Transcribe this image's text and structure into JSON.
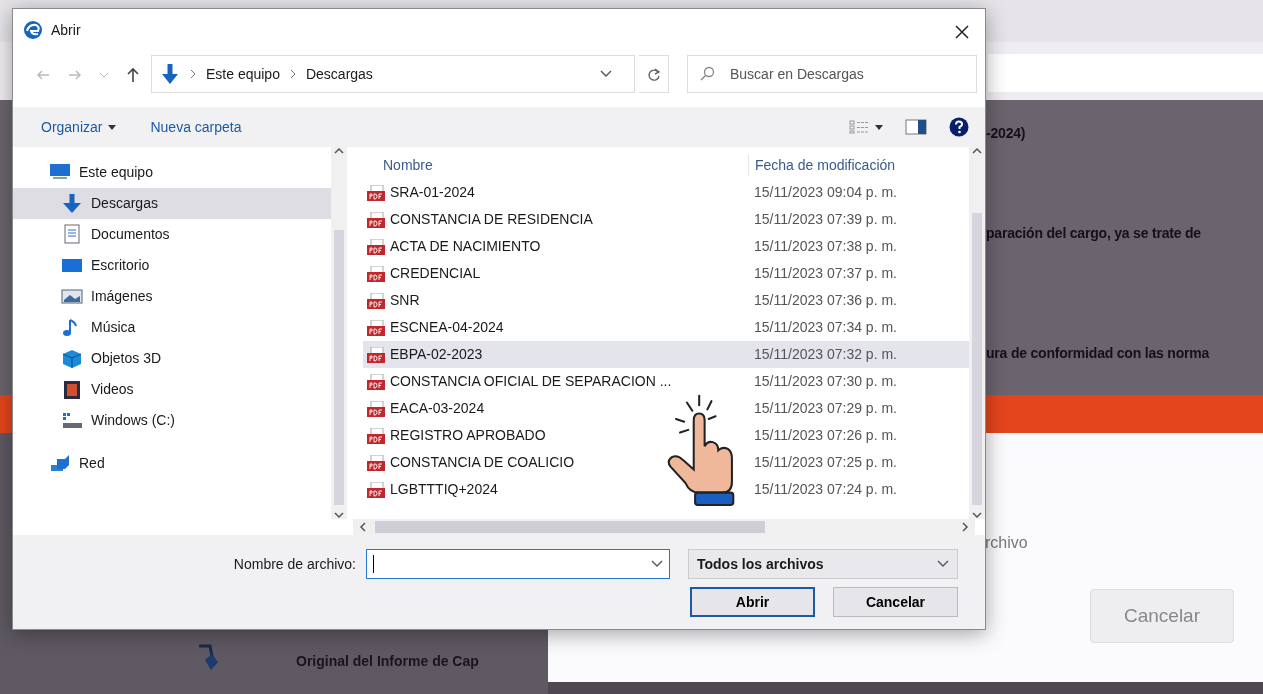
{
  "window": {
    "title": "Abrir"
  },
  "address": {
    "path": [
      "Este equipo",
      "Descargas"
    ]
  },
  "search": {
    "placeholder": "Buscar en Descargas"
  },
  "toolbar": {
    "organize": "Organizar",
    "new_folder": "Nueva carpeta"
  },
  "nav_pane": {
    "items": [
      {
        "label": "Este equipo",
        "kind": "computer",
        "selected": false,
        "children": [
          {
            "label": "Descargas",
            "kind": "downloads",
            "selected": true
          },
          {
            "label": "Documentos",
            "kind": "documents",
            "selected": false
          },
          {
            "label": "Escritorio",
            "kind": "desktop",
            "selected": false
          },
          {
            "label": "Imágenes",
            "kind": "pictures",
            "selected": false
          },
          {
            "label": "Música",
            "kind": "music",
            "selected": false
          },
          {
            "label": "Objetos 3D",
            "kind": "objects",
            "selected": false
          },
          {
            "label": "Videos",
            "kind": "videos",
            "selected": false
          },
          {
            "label": "Windows  (C:)",
            "kind": "drive",
            "selected": false
          }
        ]
      },
      {
        "label": "Red",
        "kind": "network",
        "selected": false
      }
    ]
  },
  "files": {
    "columns": [
      "Nombre",
      "Fecha de modificación"
    ],
    "rows": [
      {
        "name": "SRA-01-2024",
        "modified": "15/11/2023 09:04 p. m.",
        "selected": false
      },
      {
        "name": "CONSTANCIA DE RESIDENCIA",
        "modified": "15/11/2023 07:39 p. m.",
        "selected": false
      },
      {
        "name": "ACTA DE NACIMIENTO",
        "modified": "15/11/2023 07:38 p. m.",
        "selected": false
      },
      {
        "name": "CREDENCIAL",
        "modified": "15/11/2023 07:37 p. m.",
        "selected": false
      },
      {
        "name": "SNR",
        "modified": "15/11/2023 07:36 p. m.",
        "selected": false
      },
      {
        "name": "ESCNEA-04-2024",
        "modified": "15/11/2023 07:34 p. m.",
        "selected": false
      },
      {
        "name": "EBPA-02-2023",
        "modified": "15/11/2023 07:32 p. m.",
        "selected": true
      },
      {
        "name": "CONSTANCIA OFICIAL DE SEPARACION ...",
        "modified": "15/11/2023 07:30 p. m.",
        "selected": false
      },
      {
        "name": "EACA-03-2024",
        "modified": "15/11/2023 07:29 p. m.",
        "selected": false
      },
      {
        "name": "REGISTRO APROBADO",
        "modified": "15/11/2023 07:26 p. m.",
        "selected": false
      },
      {
        "name": "CONSTANCIA DE COALICIO",
        "modified": "15/11/2023 07:25 p. m.",
        "selected": false
      },
      {
        "name": "LGBTTTIQ+2024",
        "modified": "15/11/2023 07:24 p. m.",
        "selected": false
      }
    ]
  },
  "file_name": {
    "label": "Nombre de archivo:"
  },
  "file_type": {
    "value": "Todos los archivos"
  },
  "buttons": [
    {
      "label": "Abrir",
      "default": true
    },
    {
      "label": "Cancelar",
      "default": false
    }
  ],
  "background": {
    "heading": "-2024)",
    "lines": [
      "paración del cargo, ya se trate de",
      "ura de conformidad con las norma"
    ],
    "modal_text": "rchivo",
    "cancel": "Cancelar",
    "row_text": "Original del Informe de Cap"
  }
}
